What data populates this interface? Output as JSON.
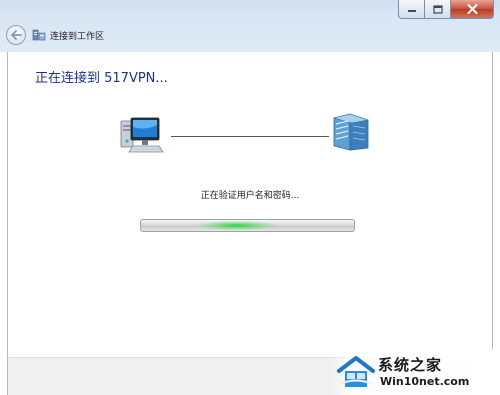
{
  "window": {
    "title": "连接到工作区"
  },
  "main": {
    "heading": "正在连接到 517VPN...",
    "status": "正在验证用户名和密码...",
    "progress_indicator_position": 0.45
  },
  "watermark": {
    "title": "系统之家",
    "site": "Win10net.com"
  },
  "colors": {
    "heading": "#1e3287",
    "progress_glow": "#28d23c",
    "close_button": "#c7503a"
  },
  "icons": {
    "back": "back-arrow-icon",
    "network": "network-folder-icon",
    "computer": "computer-icon",
    "server": "server-icon"
  }
}
